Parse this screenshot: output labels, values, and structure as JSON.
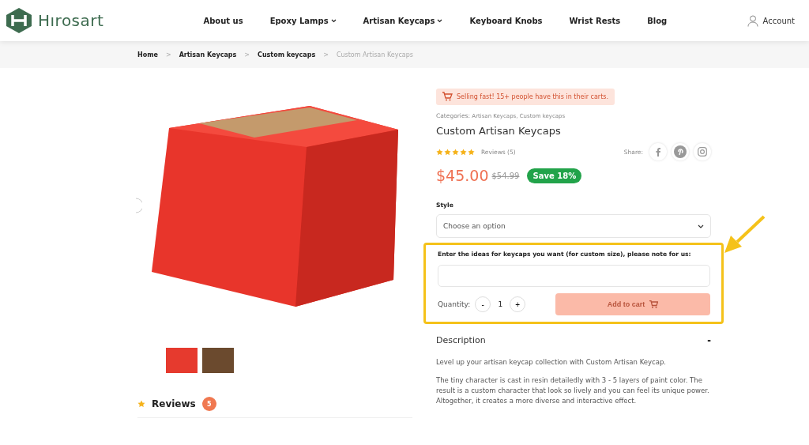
{
  "header": {
    "logo": "Hırosart",
    "nav": [
      {
        "label": "About us",
        "dropdown": false
      },
      {
        "label": "Epoxy Lamps",
        "dropdown": true
      },
      {
        "label": "Artisan Keycaps",
        "dropdown": true
      },
      {
        "label": "Keyboard Knobs",
        "dropdown": false
      },
      {
        "label": "Wrist Rests",
        "dropdown": false
      },
      {
        "label": "Blog",
        "dropdown": false
      }
    ],
    "account": "Account"
  },
  "breadcrumb": {
    "separator": ">",
    "items": [
      {
        "label": "Home",
        "current": false
      },
      {
        "label": "Artisan Keycaps",
        "current": false
      },
      {
        "label": "Custom keycaps",
        "current": false
      },
      {
        "label": "Custom Artisan Keycaps",
        "current": true
      }
    ]
  },
  "product": {
    "notice": "Selling fast!  15+ people have this in their carts.",
    "categories_label": "Categories:",
    "categories": "Artisan Keycaps, Custom keycaps",
    "title": "Custom Artisan Keycaps",
    "stars": 5,
    "reviews_link": "Reviews (5)",
    "share_label": "Share:",
    "price": "$45.00",
    "old_price": "$54.99",
    "discount": "Save 18%",
    "style_label": "Style",
    "style_placeholder": "Choose an option",
    "note_label": "Enter the ideas for keycaps you want (for custom size), please note for us:",
    "highlighted": true,
    "quantity_label": "Quantity:",
    "quantity": "1",
    "minus": "-",
    "plus": "+",
    "add_to_cart": "Add to cart",
    "add_disabled": true
  },
  "description": {
    "title": "Description",
    "expanded": true,
    "toggle": "-",
    "paragraphs": [
      "Level up your artisan keycap collection with Custom  Artisan Keycap.",
      "The tiny character is cast in resin detailedly with 3 - 5 layers of paint color. The result is a custom character that look so lively and you can feel its unique power. Altogether, it creates a more diverse and interactive effect."
    ]
  },
  "reviews": {
    "title": "Reviews",
    "count": "5"
  }
}
